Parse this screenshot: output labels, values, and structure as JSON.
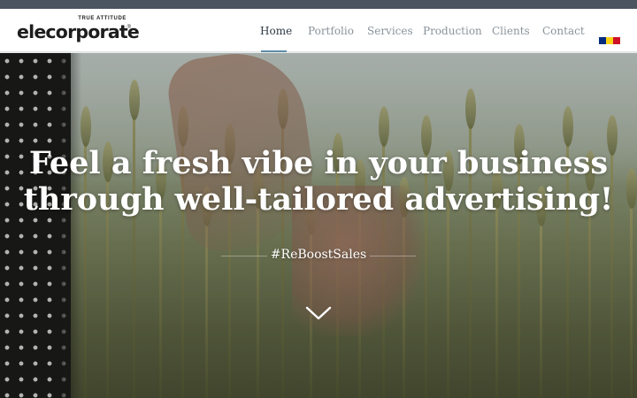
{
  "brand": {
    "tagline": "TRUE ATTITUDE",
    "name": "elecorporate",
    "registered": "®"
  },
  "nav": {
    "items": [
      {
        "label": "Home",
        "active": true
      },
      {
        "label": "Portfolio",
        "active": false
      },
      {
        "label": "Services",
        "active": false
      },
      {
        "label": "Production",
        "active": false
      },
      {
        "label": "Clients",
        "active": false
      },
      {
        "label": "Contact",
        "active": false
      }
    ],
    "language_flag": "romanian-flag-icon"
  },
  "hero": {
    "headline_line1": "Feel a fresh vibe in your business",
    "headline_line2": "through well-tailored advertising!",
    "hashtag": "#ReBoostSales",
    "scroll_icon": "chevron-down-icon"
  },
  "colors": {
    "top_strip": "#4a5561",
    "nav_active": "#2f3a44",
    "nav_inactive": "#8a939b",
    "nav_underline": "#5f8ca6",
    "flag_blue": "#002b7f",
    "flag_yellow": "#fcd116",
    "flag_red": "#ce1126",
    "headline": "#ffffff"
  }
}
